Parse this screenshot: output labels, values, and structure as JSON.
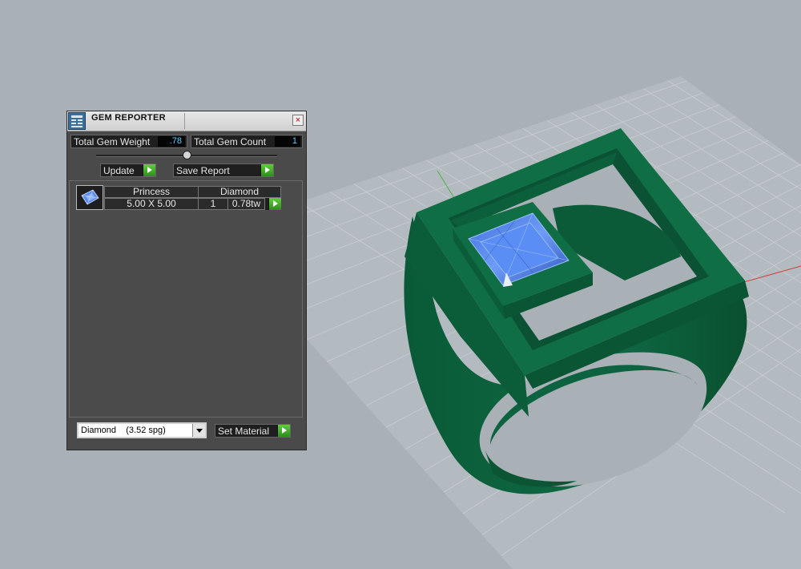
{
  "panel": {
    "title": "GEM REPORTER",
    "close_label": "×",
    "total_weight_label": "Total Gem Weight",
    "total_weight_value": ".78",
    "total_count_label": "Total Gem Count",
    "total_count_value": "1",
    "slider_position": 0.5,
    "update_label": "Update",
    "save_report_label": "Save Report",
    "gems": [
      {
        "shape": "Princess",
        "material": "Diamond",
        "size": "5.00 X 5.00",
        "count": "1",
        "weight": "0.78tw"
      }
    ],
    "material_select": "Diamond    (3.52 spg)",
    "set_material_label": "Set Material"
  },
  "colors": {
    "background": "#a9b0b6",
    "ring": "#0f6e44",
    "gem": "#4f86f0",
    "accent_green": "#3fb526"
  },
  "icons": {
    "app": "gem-reporter-app-icon",
    "close": "close-icon",
    "go": "green-play-arrow-icon",
    "dropdown": "chevron-down-icon"
  }
}
